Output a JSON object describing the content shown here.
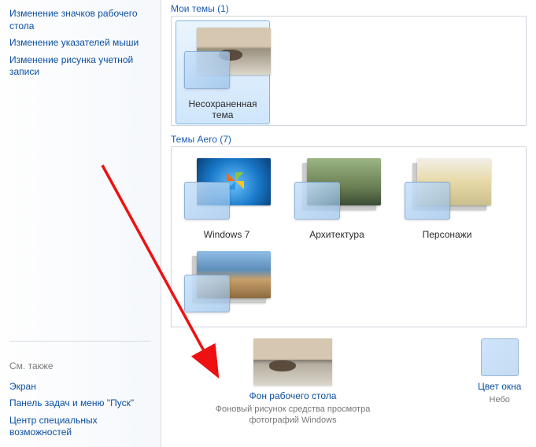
{
  "sidebar": {
    "top_links": [
      "Изменение значков рабочего стола",
      "Изменение указателей мыши",
      "Изменение рисунка учетной записи"
    ],
    "see_also_label": "См. также",
    "bottom_links": [
      "Экран",
      "Панель задач и меню \"Пуск\"",
      "Центр специальных возможностей"
    ]
  },
  "sections": {
    "my_themes": {
      "title": "Мои темы (1)",
      "items": [
        {
          "label": "Несохраненная тема",
          "bg_class": "bg-cat",
          "selected": true
        }
      ]
    },
    "aero": {
      "title": "Темы Aero (7)",
      "items": [
        {
          "label": "Windows 7",
          "bg_class": "bg-win7"
        },
        {
          "label": "Архитектура",
          "bg_class": "bg-arch"
        },
        {
          "label": "Персонажи",
          "bg_class": "bg-chars"
        },
        {
          "label": "",
          "bg_class": "bg-land1"
        }
      ]
    }
  },
  "bottom": {
    "wallpaper_link": "Фон рабочего стола",
    "wallpaper_desc": "Фоновый рисунок средства просмотра фотографий Windows",
    "color_link": "Цвет окна",
    "color_desc": "Небо"
  }
}
